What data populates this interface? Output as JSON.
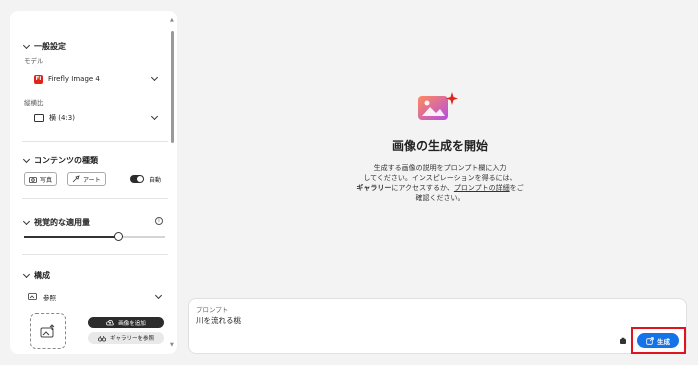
{
  "sidebar": {
    "general": {
      "heading": "一般設定",
      "model_label": "モデル",
      "model_value": "Firefly Image 4",
      "model_badge": "Fi",
      "ratio_label": "縦横比",
      "ratio_value": "横 (4:3)"
    },
    "content_type": {
      "heading": "コンテンツの種類",
      "photo_label": "写真",
      "art_label": "アート",
      "auto_label": "自動",
      "auto_on": true
    },
    "visual_intensity": {
      "heading": "視覚的な適用量",
      "info": "i",
      "level_fraction": 0.67
    },
    "composition": {
      "heading": "構成",
      "reference_label": "参照",
      "add_image_label": "画像を追加",
      "browse_gallery_label": "ギャラリーを参照"
    }
  },
  "main": {
    "title": "画像の生成を開始",
    "desc_line1": "生成する画像の説明をプロンプト欄に入力",
    "desc_line2": "してください。インスピレーションを得るには、",
    "desc_bold": "ギャラリー",
    "desc_line3a": "にアクセスするか、",
    "desc_link": "プロンプトの詳細",
    "desc_line3b": "をご",
    "desc_line4": "確認ください。"
  },
  "prompt": {
    "label": "プロンプト",
    "value": "川を流れる桃",
    "generate_label": "生成"
  },
  "colors": {
    "accent": "#1473e6",
    "highlight": "#e0141e",
    "badge": "#e0241b"
  }
}
